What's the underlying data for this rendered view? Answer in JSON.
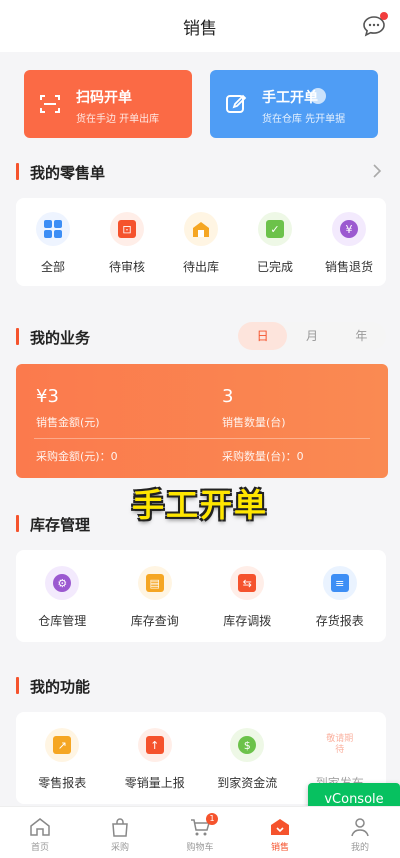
{
  "header": {
    "title": "销售"
  },
  "quick_actions": [
    {
      "title": "扫码开单",
      "subtitle": "货在手边 开单出库",
      "color": "#fb6a45"
    },
    {
      "title": "手工开单",
      "subtitle": "货在仓库 先开单据",
      "color": "#4f9df5"
    }
  ],
  "retail": {
    "title": "我的零售单",
    "items": [
      {
        "label": "全部",
        "icon": "grid-icon"
      },
      {
        "label": "待审核",
        "icon": "review-icon"
      },
      {
        "label": "待出库",
        "icon": "warehouse-out-icon"
      },
      {
        "label": "已完成",
        "icon": "clipboard-check-icon"
      },
      {
        "label": "销售退货",
        "icon": "yen-return-icon"
      }
    ]
  },
  "business": {
    "title": "我的业务",
    "periods": [
      "日",
      "月",
      "年"
    ],
    "active_period": "日",
    "sales_amount": "¥3",
    "sales_amount_label": "销售金额(元)",
    "sales_qty": "3",
    "sales_qty_label": "销售数量(台)",
    "purchase_amount": "采购金额(元)：0",
    "purchase_qty": "采购数量(台)：0"
  },
  "overlay_caption": "手工开单",
  "inventory": {
    "title": "库存管理",
    "items": [
      {
        "label": "仓库管理",
        "icon": "warehouse-icon"
      },
      {
        "label": "库存查询",
        "icon": "stock-query-icon"
      },
      {
        "label": "库存调拨",
        "icon": "transfer-icon"
      },
      {
        "label": "存货报表",
        "icon": "report-icon"
      }
    ]
  },
  "functions": {
    "title": "我的功能",
    "items": [
      {
        "label": "零售报表",
        "icon": "chart-icon"
      },
      {
        "label": "零销量上报",
        "icon": "upload-icon"
      },
      {
        "label": "到家资金流",
        "icon": "money-flow-icon"
      },
      {
        "label": "到家发布",
        "icon": "publish-icon",
        "badge": "敬请期待"
      }
    ]
  },
  "vconsole": "vConsole",
  "tabs": [
    {
      "label": "首页",
      "icon": "home-icon"
    },
    {
      "label": "采购",
      "icon": "bag-icon"
    },
    {
      "label": "购物车",
      "icon": "cart-icon",
      "badge": "1"
    },
    {
      "label": "销售",
      "icon": "sales-icon"
    },
    {
      "label": "我的",
      "icon": "user-icon"
    }
  ],
  "accent_color": "#f5532d"
}
